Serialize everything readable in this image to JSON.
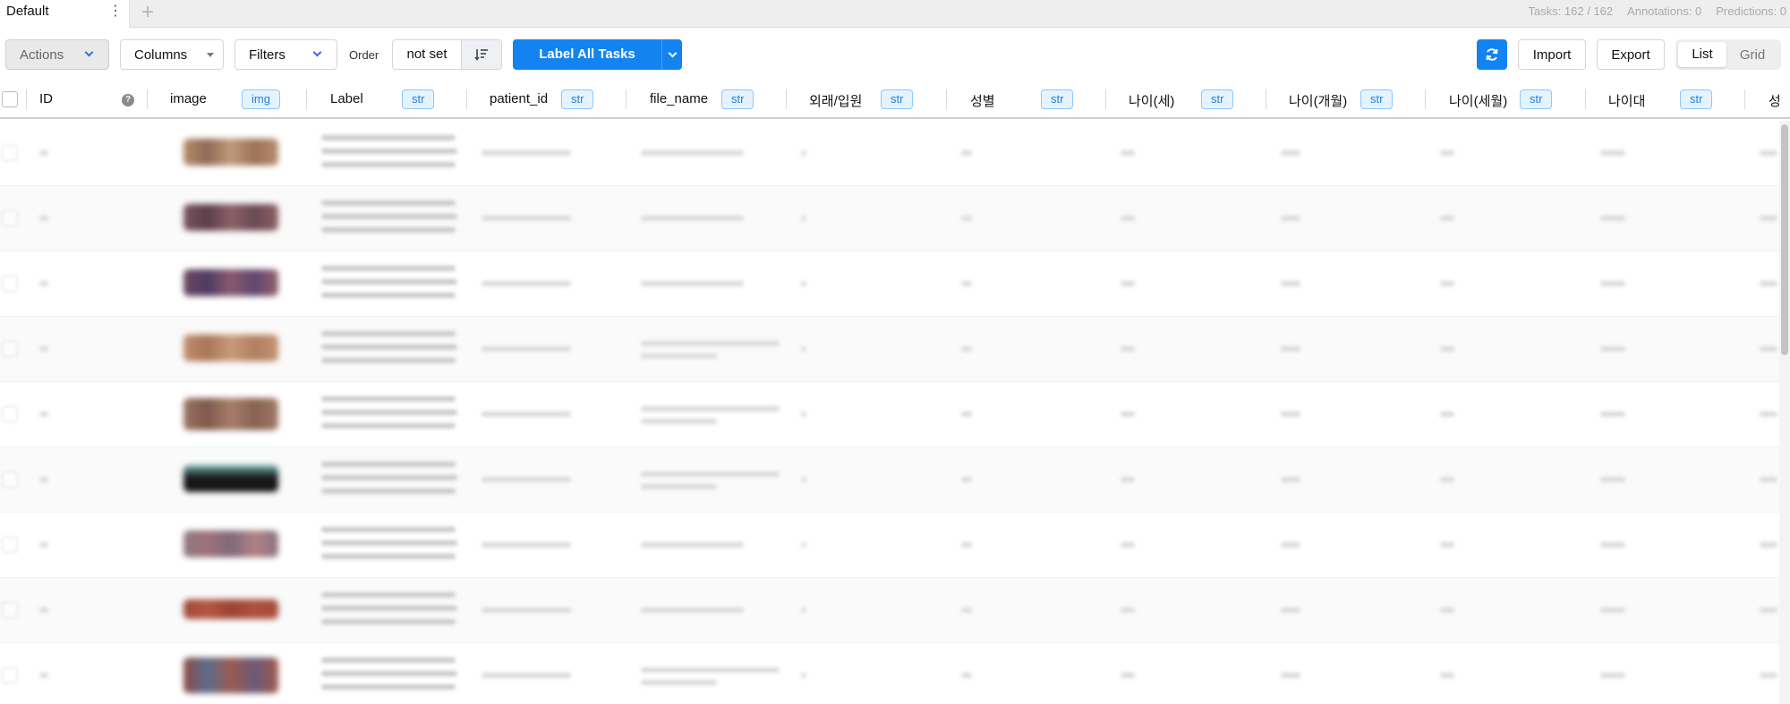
{
  "tabs": {
    "active_label": "Default",
    "menu_icon": "⋮",
    "add_icon": "+"
  },
  "stats": {
    "tasks": "Tasks: 162 / 162",
    "annotations": "Annotations: 0",
    "predictions": "Predictions: 0"
  },
  "toolbar": {
    "actions_label": "Actions",
    "columns_label": "Columns",
    "filters_label": "Filters",
    "order_label": "Order",
    "order_value": "not set",
    "label_all_label": "Label All Tasks",
    "import_label": "Import",
    "export_label": "Export",
    "view_list_label": "List",
    "view_grid_label": "Grid",
    "colors": {
      "primary": "#1383f0",
      "badge_bg": "#e5f3ff",
      "badge_border": "#8cc7ff"
    }
  },
  "table": {
    "columns": [
      {
        "label": "ID",
        "type": ""
      },
      {
        "label": "image",
        "type": "img"
      },
      {
        "label": "Label",
        "type": "str"
      },
      {
        "label": "patient_id",
        "type": "str"
      },
      {
        "label": "file_name",
        "type": "str"
      },
      {
        "label": "외래/입원",
        "type": "str"
      },
      {
        "label": "성별",
        "type": "str"
      },
      {
        "label": "나이(세)",
        "type": "str"
      },
      {
        "label": "나이(개월)",
        "type": "str"
      },
      {
        "label": "나이(세월)",
        "type": "str"
      },
      {
        "label": "나이대",
        "type": "str"
      },
      {
        "label": "성",
        "type": ""
      }
    ]
  }
}
